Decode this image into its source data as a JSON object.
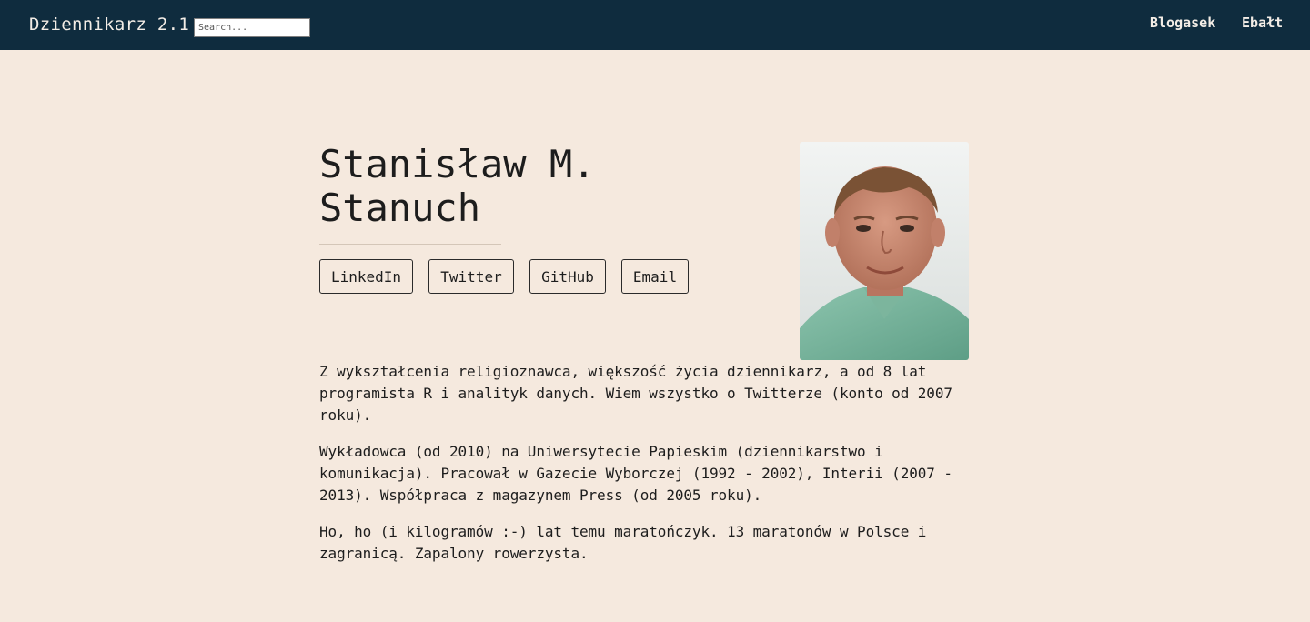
{
  "navbar": {
    "brand": "Dziennikarz 2.1",
    "search_placeholder": "Search...",
    "links": [
      "Blogasek",
      "Ebałt"
    ]
  },
  "profile": {
    "name": "Stanisław M. Stanuch",
    "social_links": [
      "LinkedIn",
      "Twitter",
      "GitHub",
      "Email"
    ]
  },
  "bio": {
    "paragraphs": [
      "Z wykształcenia religioznawca, większość życia dziennikarz, a od 8 lat programista R i analityk danych. Wiem wszystko o Twitterze (konto od 2007 roku).",
      "Wykładowca (od 2010) na Uniwersytecie Papieskim (dziennikarstwo i komunikacja). Pracował w Gazecie Wyborczej (1992 - 2002), Interii (2007 - 2013). Współpraca z magazynem Press (od 2005 roku).",
      "Ho, ho (i kilogramów :-) lat temu maratończyk. 13 maratonów w Polsce i zagranicą. Zapalony rowerzysta."
    ]
  },
  "colors": {
    "navbar_bg": "#0f2c3e",
    "page_bg": "#f5e9de",
    "text": "#1d1d1d"
  }
}
